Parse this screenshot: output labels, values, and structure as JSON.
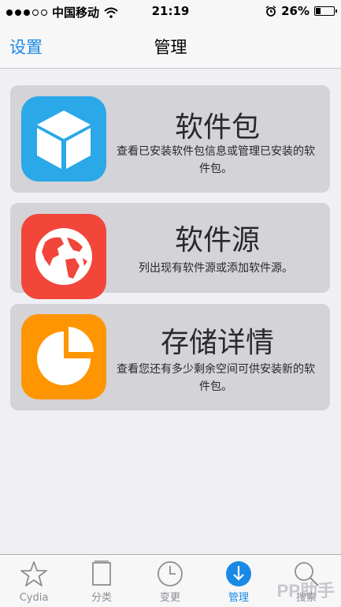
{
  "status_bar": {
    "carrier": "中国移动",
    "time": "21:19",
    "battery_percent": "26%",
    "battery_level": 0.26,
    "signal_bars_filled": 3,
    "signal_bars_total": 5
  },
  "nav": {
    "back_label": "设置",
    "title": "管理"
  },
  "cards": [
    {
      "title": "软件包",
      "description": "查看已安装软件包信息或管理已安装的软件包。",
      "icon": "package-box-icon",
      "icon_color": "#2aa8e8"
    },
    {
      "title": "软件源",
      "description": "列出现有软件源或添加软件源。",
      "icon": "globe-icon",
      "icon_color": "#f2463a"
    },
    {
      "title": "存储详情",
      "description": "查看您还有多少剩余空间可供安装新的软件包。",
      "icon": "pie-chart-icon",
      "icon_color": "#ff9500"
    }
  ],
  "tabs": [
    {
      "label": "Cydia",
      "icon": "star-icon"
    },
    {
      "label": "分类",
      "icon": "sections-icon"
    },
    {
      "label": "变更",
      "icon": "clock-icon"
    },
    {
      "label": "管理",
      "icon": "manage-download-icon",
      "active": true
    },
    {
      "label": "搜索",
      "icon": "search-icon"
    }
  ],
  "watermark": "PP助手",
  "colors": {
    "accent": "#1a8ae6",
    "card_bg": "#d3d3d8",
    "page_bg": "#efeff4"
  }
}
